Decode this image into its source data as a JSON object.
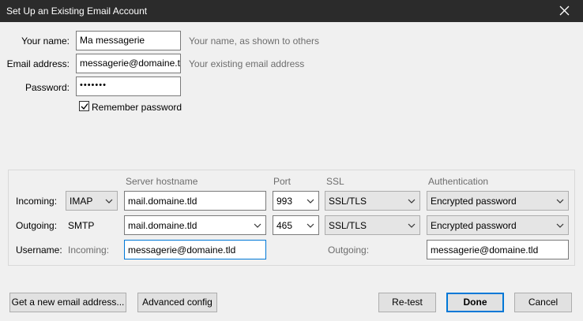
{
  "window": {
    "title": "Set Up an Existing Email Account"
  },
  "identity": {
    "name_label": "Your name:",
    "name_value": "Ma messagerie",
    "name_hint": "Your name, as shown to others",
    "email_label": "Email address:",
    "email_value": "messagerie@domaine.tld",
    "email_hint": "Your existing email address",
    "password_label": "Password:",
    "password_value": "•••••••",
    "remember_label": "Remember password",
    "remember_checked": true
  },
  "servers": {
    "col_hostname": "Server hostname",
    "col_port": "Port",
    "col_ssl": "SSL",
    "col_auth": "Authentication",
    "incoming": {
      "label": "Incoming:",
      "protocol": "IMAP",
      "hostname": "mail.domaine.tld",
      "port": "993",
      "ssl": "SSL/TLS",
      "auth": "Encrypted password"
    },
    "outgoing": {
      "label": "Outgoing:",
      "protocol": "SMTP",
      "hostname": "mail.domaine.tld",
      "port": "465",
      "ssl": "SSL/TLS",
      "auth": "Encrypted password"
    },
    "username": {
      "label": "Username:",
      "incoming_label": "Incoming:",
      "incoming_value": "messagerie@domaine.tld",
      "outgoing_label": "Outgoing:",
      "outgoing_value": "messagerie@domaine.tld"
    }
  },
  "buttons": {
    "new_email": "Get a new email address...",
    "advanced": "Advanced config",
    "retest": "Re-test",
    "done": "Done",
    "cancel": "Cancel"
  }
}
